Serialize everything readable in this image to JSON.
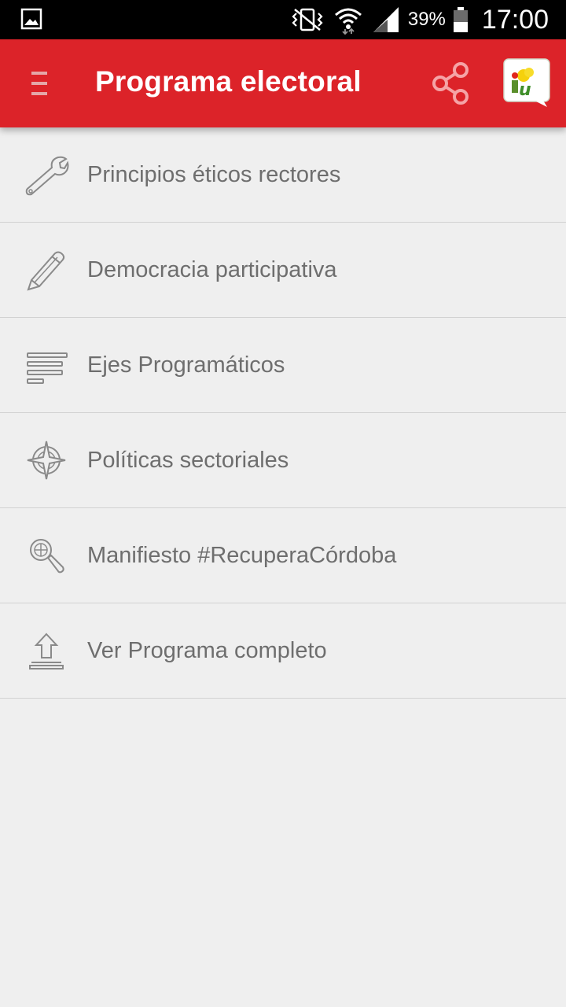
{
  "status_bar": {
    "battery": "39%",
    "time": "17:00",
    "icons": [
      "image-notification-icon",
      "vibrate-icon",
      "wifi-icon",
      "signal-icon",
      "battery-icon"
    ]
  },
  "app_bar": {
    "title": "Programa electoral",
    "color": "#dc2329",
    "icons": [
      "menu-icon",
      "share-icon",
      "iu-logo"
    ]
  },
  "menu": {
    "items": [
      {
        "label": "Principios éticos rectores",
        "icon": "wrench-icon"
      },
      {
        "label": "Democracia participativa",
        "icon": "pencil-icon"
      },
      {
        "label": "Ejes Programáticos",
        "icon": "lines-icon"
      },
      {
        "label": "Políticas sectoriales",
        "icon": "compass-icon"
      },
      {
        "label": "Manifiesto #RecuperaCórdoba",
        "icon": "magnifier-globe-icon"
      },
      {
        "label": "Ver Programa completo",
        "icon": "upload-icon"
      }
    ]
  }
}
